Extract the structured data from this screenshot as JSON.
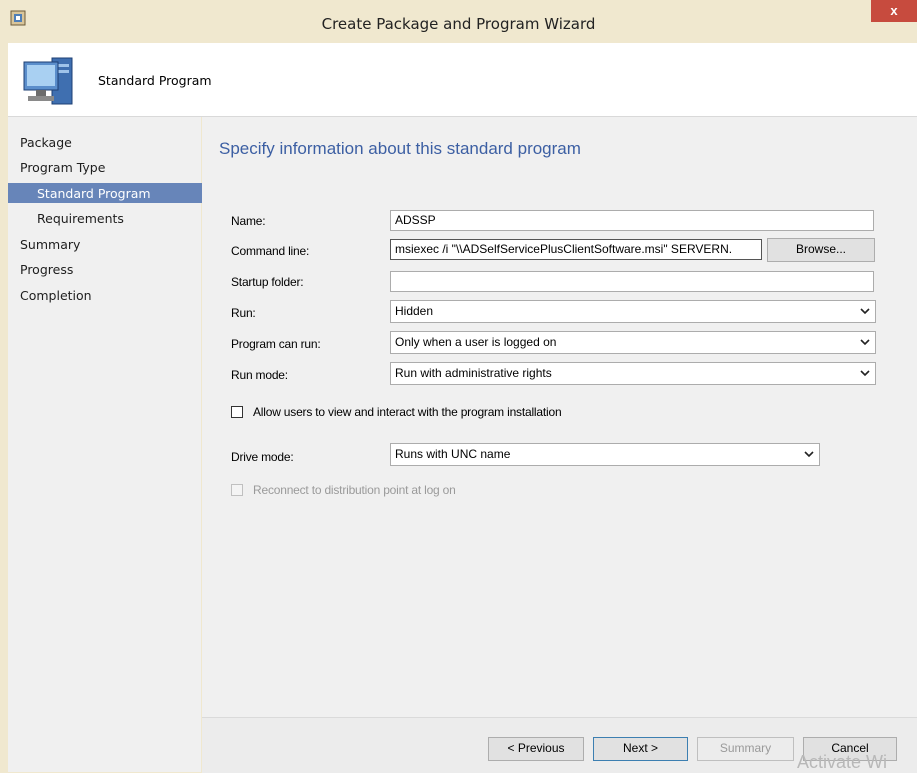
{
  "window": {
    "title": "Create Package and Program Wizard",
    "close_label": "x"
  },
  "header": {
    "title": "Standard Program"
  },
  "nav": {
    "items": [
      {
        "label": "Package"
      },
      {
        "label": "Program Type"
      },
      {
        "label": "Standard Program",
        "selected": true
      },
      {
        "label": "Requirements"
      },
      {
        "label": "Summary"
      },
      {
        "label": "Progress"
      },
      {
        "label": "Completion"
      }
    ]
  },
  "page": {
    "heading": "Specify information about this standard program"
  },
  "form": {
    "name_label": "Name:",
    "name_value": "ADSSP",
    "cmd_label": "Command line:",
    "cmd_value": "msiexec /i \"\\\\ADSelfServicePlusClientSoftware.msi\" SERVERN.",
    "browse_label": "Browse...",
    "startup_label": "Startup folder:",
    "startup_value": "",
    "run_label": "Run:",
    "run_value": "Hidden",
    "canrun_label": "Program can run:",
    "canrun_value": "Only when a user is logged on",
    "runmode_label": "Run mode:",
    "runmode_value": "Run with administrative rights",
    "allow_label": "Allow users to view and interact with the program installation",
    "allow_checked": false,
    "drive_label": "Drive mode:",
    "drive_value": "Runs with UNC name",
    "reconnect_label": "Reconnect to distribution point at log on",
    "reconnect_checked": false
  },
  "buttons": {
    "previous": "< Previous",
    "next": "Next >",
    "summary": "Summary",
    "cancel": "Cancel"
  },
  "watermark": "Activate Wi",
  "colors": {
    "heading": "#3c5fa3",
    "nav_selected": "#6785b9",
    "close": "#c74b3e"
  },
  "icons": [
    "package-app-icon",
    "computer-icon",
    "chevron-down-icon"
  ]
}
